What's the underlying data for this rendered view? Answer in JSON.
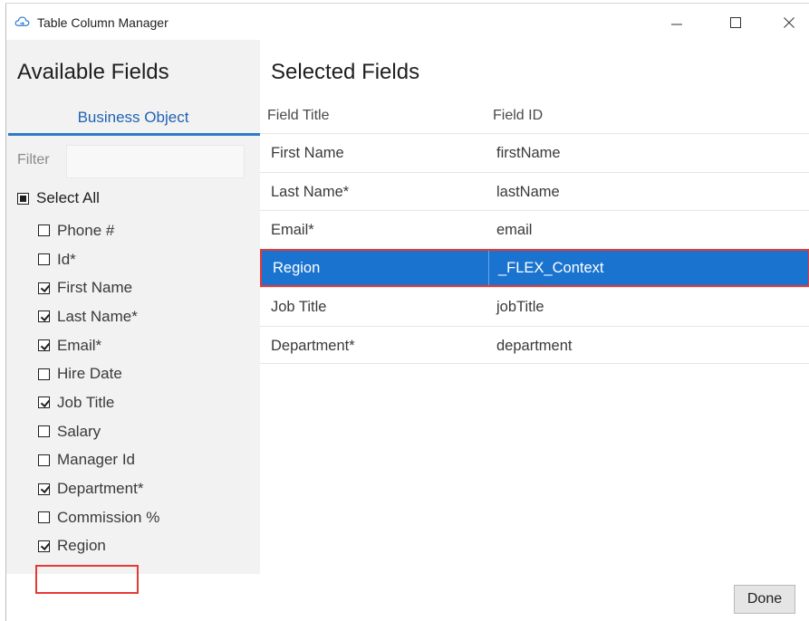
{
  "window": {
    "title": "Table Column Manager",
    "controls": {
      "minimize": "—",
      "maximize": "☐",
      "close": "✕"
    }
  },
  "available": {
    "title": "Available Fields",
    "tab_label": "Business Object",
    "filter_label": "Filter",
    "filter_value": "",
    "select_all_label": "Select All",
    "select_all_state": "partial",
    "fields": [
      {
        "label": "Phone #",
        "checked": false
      },
      {
        "label": "Id*",
        "checked": false
      },
      {
        "label": "First Name",
        "checked": true
      },
      {
        "label": "Last Name*",
        "checked": true
      },
      {
        "label": "Email*",
        "checked": true
      },
      {
        "label": "Hire Date",
        "checked": false
      },
      {
        "label": "Job Title",
        "checked": true
      },
      {
        "label": "Salary",
        "checked": false
      },
      {
        "label": "Manager Id",
        "checked": false
      },
      {
        "label": "Department*",
        "checked": true
      },
      {
        "label": "Commission %",
        "checked": false
      },
      {
        "label": "Region",
        "checked": true
      }
    ]
  },
  "selected": {
    "title": "Selected Fields",
    "columns": {
      "field_title": "Field Title",
      "field_id": "Field ID"
    },
    "rows": [
      {
        "title": "First Name",
        "id": "firstName"
      },
      {
        "title": "Last Name*",
        "id": "lastName"
      },
      {
        "title": "Email*",
        "id": "email"
      },
      {
        "title": "Region",
        "id": "_FLEX_Context"
      },
      {
        "title": "Job Title",
        "id": "jobTitle"
      },
      {
        "title": "Department*",
        "id": "department"
      }
    ],
    "selected_row_index": 3
  },
  "footer": {
    "done_label": "Done"
  },
  "colors": {
    "accent": "#1a73cf",
    "tab_text": "#1f63b3",
    "highlight": "#e53935",
    "left_panel_bg": "#f2f2f2"
  }
}
